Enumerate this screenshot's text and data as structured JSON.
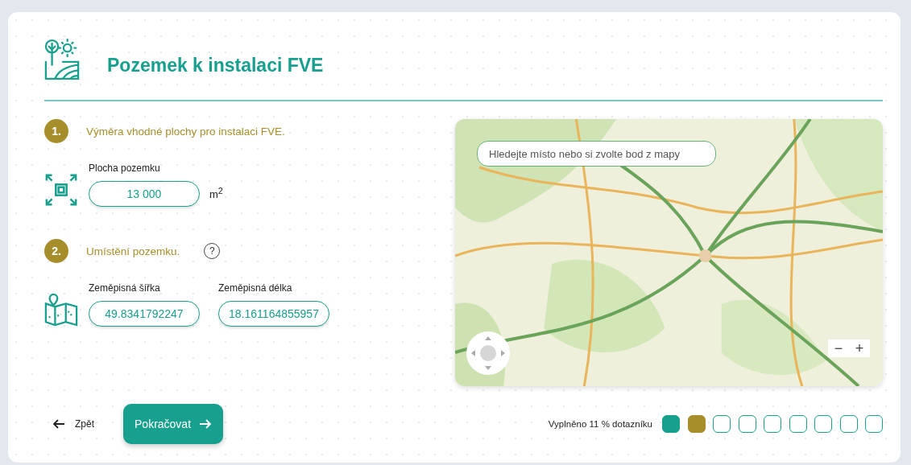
{
  "header": {
    "title": "Pozemek k instalaci FVE"
  },
  "steps": [
    {
      "number": "1.",
      "title": "Výměra vhodné plochy pro instalaci FVE."
    },
    {
      "number": "2.",
      "title": "Umístění pozemku.",
      "help": "?"
    }
  ],
  "area_field": {
    "label": "Plocha pozemku",
    "value": "13 000",
    "unit": "m$^{2}$"
  },
  "coordinates": [
    {
      "label": "Zeměpisná šířka",
      "value": "49.8341792247"
    },
    {
      "label": "Zeměpisná délka",
      "value": "18.161164855957"
    }
  ],
  "map": {
    "search_placeholder": "Hledejte místo nebo si zvolte bod z mapy",
    "zoom_out": "−",
    "zoom_in": "+"
  },
  "footer": {
    "back": "Zpět",
    "continue": "Pokračovat",
    "progress_text": "Vyplněno 11 % dotazníku",
    "progress": [
      {
        "kind": "done"
      },
      {
        "kind": "current"
      },
      {
        "kind": "todo"
      },
      {
        "kind": "todo"
      },
      {
        "kind": "todo"
      },
      {
        "kind": "todo"
      },
      {
        "kind": "todo"
      },
      {
        "kind": "todo"
      },
      {
        "kind": "todo"
      }
    ]
  }
}
